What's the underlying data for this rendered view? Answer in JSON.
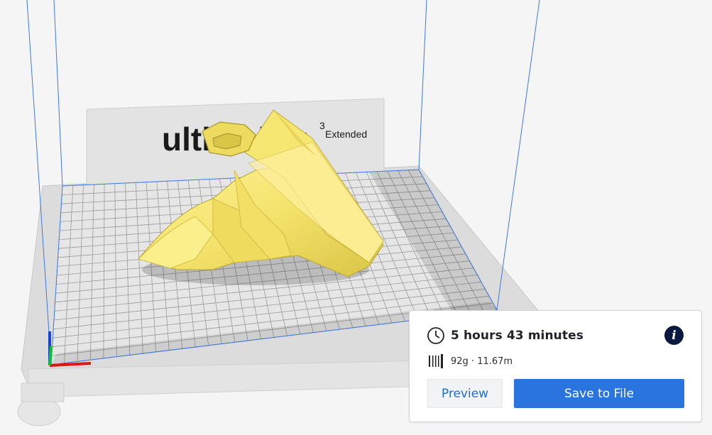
{
  "viewport": {
    "backplate_brand": "ultimaker",
    "backplate_superscript": "3",
    "backplate_model": "Extended"
  },
  "print_panel": {
    "time": "5 hours 43 minutes",
    "material": "92g · 11.67m",
    "info_icon": "info-icon",
    "preview_label": "Preview",
    "save_label": "Save to File"
  },
  "colors": {
    "model": "#f4e36c",
    "accent": "#2a74e0",
    "preview_text": "#1a6fd8",
    "info_bg": "#0b1b3f"
  }
}
